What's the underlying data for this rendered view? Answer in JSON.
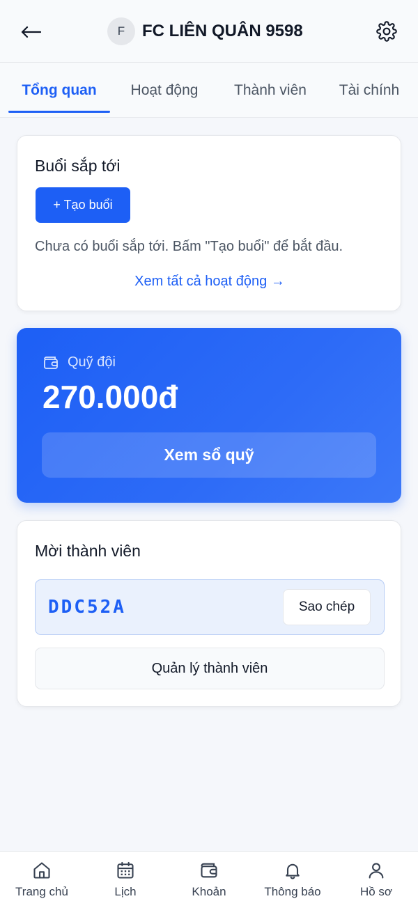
{
  "header": {
    "back_icon": "arrow-left-icon",
    "avatar_letter": "F",
    "club_name": "FC LIÊN QUÂN 9598",
    "settings_icon": "gear-icon"
  },
  "tabs": [
    {
      "label": "Tổng quan",
      "active": true
    },
    {
      "label": "Hoạt động",
      "active": false
    },
    {
      "label": "Thành viên",
      "active": false
    },
    {
      "label": "Tài chính",
      "active": false
    }
  ],
  "upcoming": {
    "title": "Buổi sắp tới",
    "create_button": "+ Tạo buổi",
    "empty_text": "Chưa có buổi sắp tới. Bấm \"Tạo buổi\" để bắt đầu.",
    "view_all": "Xem tất cả hoạt động →"
  },
  "fund": {
    "icon": "wallet-icon",
    "label": "Quỹ đội",
    "amount": "270.000đ",
    "button": "Xem sổ quỹ"
  },
  "invite": {
    "title": "Mời thành viên",
    "code": "DDC52A",
    "copy_button": "Sao chép",
    "manage_button": "Quản lý thành viên"
  },
  "bottom_nav": [
    {
      "label": "Trang chủ",
      "icon": "home-icon"
    },
    {
      "label": "Lịch",
      "icon": "calendar-icon"
    },
    {
      "label": "Khoản",
      "icon": "wallet-icon"
    },
    {
      "label": "Thông báo",
      "icon": "bell-icon"
    },
    {
      "label": "Hồ sơ",
      "icon": "user-icon"
    }
  ],
  "colors": {
    "accent": "#1d5ff5",
    "background": "#f5f7fb",
    "invite_bg": "#eaf1fd"
  }
}
